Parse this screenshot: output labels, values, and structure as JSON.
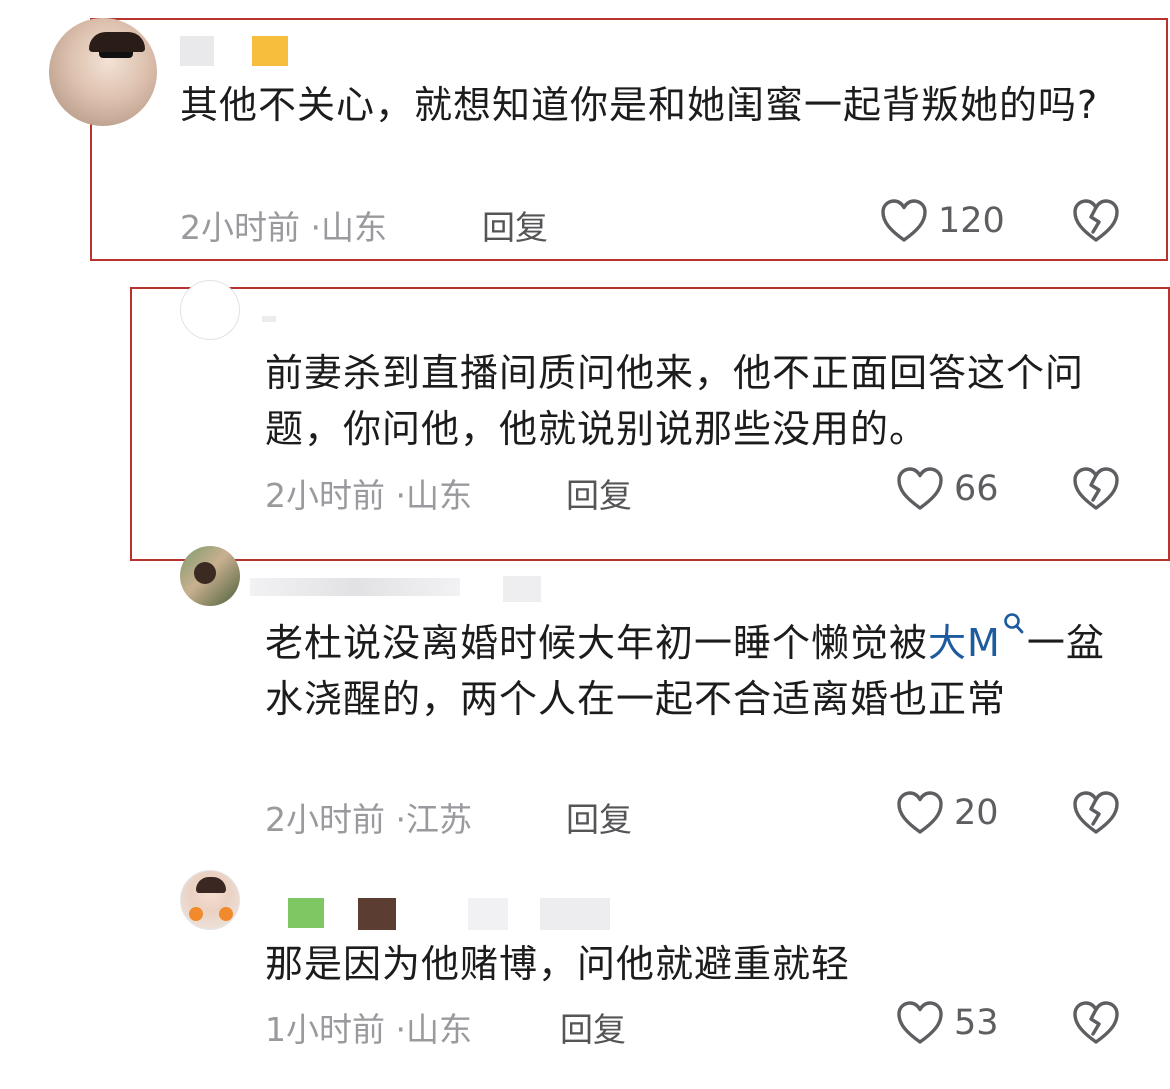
{
  "comments": [
    {
      "text": "其他不关心，就想知道你是和她闺蜜一起背叛她的吗?",
      "time": "2小时前",
      "location": "山东",
      "reply": "回复",
      "likes": "120"
    },
    {
      "text": "前妻杀到直播间质问他来，他不正面回答这个问题，你问他，他就说别说那些没用的。",
      "time": "2小时前",
      "location": "山东",
      "reply": "回复",
      "likes": "66"
    },
    {
      "text_before": "老杜说没离婚时候大年初一睡个懒觉被",
      "mention": "大M",
      "text_after": "一盆水浇醒的，两个人在一起不合适离婚也正常",
      "time": "2小时前",
      "location": "江苏",
      "reply": "回复",
      "likes": "20"
    },
    {
      "text": "那是因为他赌博，问他就避重就轻",
      "time": "1小时前",
      "location": "山东",
      "reply": "回复",
      "likes": "53"
    }
  ],
  "meta_separator": "·",
  "colors": {
    "highlight_border": "#b8332d",
    "mention": "#1d5a9e",
    "meta": "#9a9a9e"
  },
  "icons": [
    "heart-outline-icon",
    "broken-heart-icon",
    "search-icon"
  ]
}
